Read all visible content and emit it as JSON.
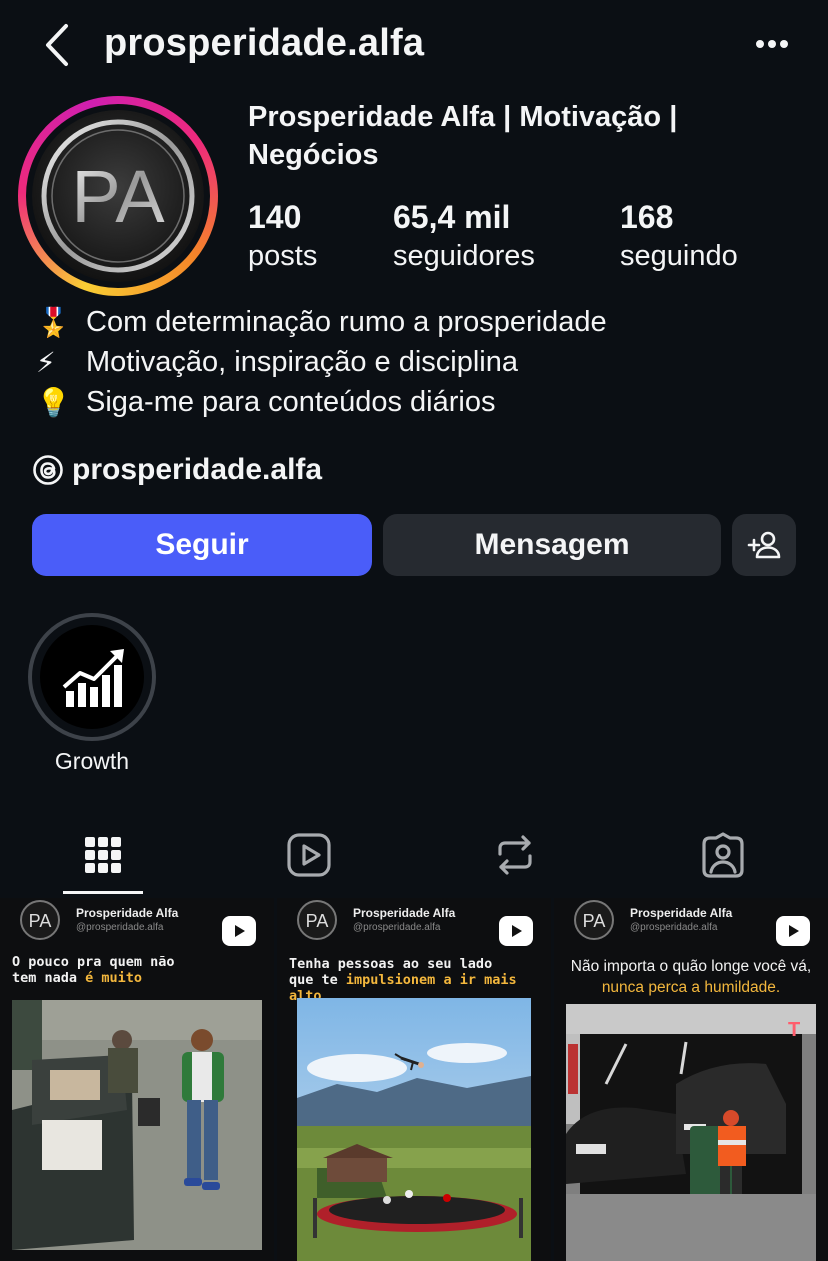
{
  "header": {
    "username": "prosperidade.alfa"
  },
  "profile": {
    "display_name": "Prosperidade Alfa | Motivação | Negócios",
    "avatar_monogram": "PA",
    "stats": [
      {
        "value": "140",
        "label": "posts"
      },
      {
        "value": "65,4 mil",
        "label": "seguidores"
      },
      {
        "value": "168",
        "label": "seguindo"
      }
    ],
    "bio": [
      {
        "emoji": "🎖️",
        "text": "Com determinação rumo a prosperidade"
      },
      {
        "emoji": "⚡",
        "text": "Motivação, inspiração e disciplina"
      },
      {
        "emoji": "💡",
        "text": "Siga-me para conteúdos diários"
      }
    ],
    "threads_handle": "prosperidade.alfa"
  },
  "actions": {
    "follow_label": "Seguir",
    "message_label": "Mensagem"
  },
  "highlights": [
    {
      "label": "Growth"
    }
  ],
  "tabs": [
    {
      "name": "grid",
      "icon": "grid-icon",
      "active": true
    },
    {
      "name": "reels",
      "icon": "reels-icon",
      "active": false
    },
    {
      "name": "reposts",
      "icon": "repost-icon",
      "active": false
    },
    {
      "name": "tagged",
      "icon": "tagged-icon",
      "active": false
    }
  ],
  "posts": [
    {
      "account_name": "Prosperidade Alfa",
      "account_handle": "@prosperidade.alfa",
      "caption_line1": "O pouco pra quem não",
      "caption_line2_plain": "tem nada ",
      "caption_line2_highlight": "é muito"
    },
    {
      "account_name": "Prosperidade Alfa",
      "account_handle": "@prosperidade.alfa",
      "caption_line1": "Tenha pessoas ao seu lado",
      "caption_line2_plain": "que te ",
      "caption_line2_highlight": "impulsionem a ir mais alto"
    },
    {
      "account_name": "Prosperidade Alfa",
      "account_handle": "@prosperidade.alfa",
      "caption_line1": "Não importa o quão longe você vá,",
      "caption_line2_plain": "",
      "caption_line2_highlight": "nunca perca a humildade."
    }
  ],
  "colors": {
    "background": "#0b0f14",
    "follow_button": "#4a5df9",
    "secondary_button": "#262a30",
    "caption_highlight": "#f3b73d"
  }
}
